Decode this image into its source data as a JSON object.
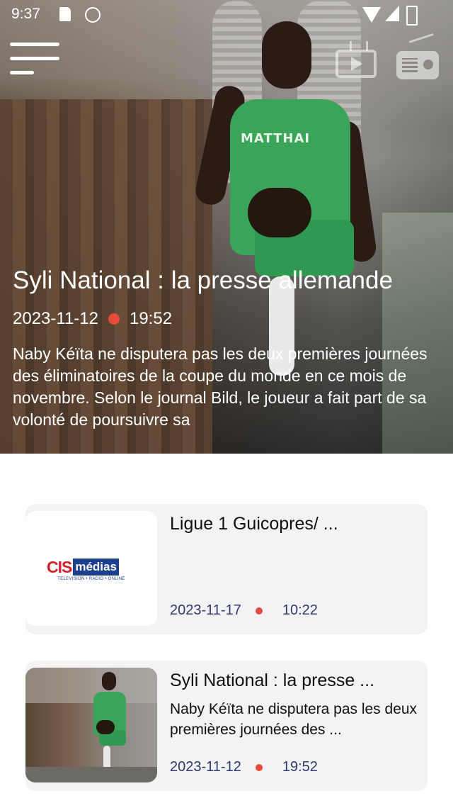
{
  "status_bar": {
    "time": "9:37"
  },
  "header": {
    "menu_icon": "hamburger-menu-icon",
    "tv_icon": "tv-play-icon",
    "radio_icon": "radio-icon"
  },
  "hero": {
    "title": "Syli National : la presse allemande",
    "date": "2023-11-12",
    "time": "19:52",
    "excerpt": "Naby Kéïta ne disputera pas les deux premières journées des éliminatoires de la coupe du monde en ce mois de novembre. Selon le journal Bild, le joueur a fait part de sa volonté de poursuivre sa",
    "jersey_sponsor": "MATTHAI"
  },
  "articles": [
    {
      "title": "Ligue 1 Guicopres/ ...",
      "excerpt": "",
      "date": "2023-11-17",
      "time": "10:22",
      "thumb": {
        "logo_main": "CIS",
        "logo_badge": "médias",
        "logo_sub": "TELEVISION  •  RADIO  •  ONLINE"
      }
    },
    {
      "title": "Syli National : la presse ...",
      "excerpt": "Naby Kéïta ne disputera pas les deux premières journées des ...",
      "date": "2023-11-12",
      "time": "19:52"
    }
  ],
  "colors": {
    "accent_dot": "#e84b3c",
    "meta_text": "#2e3a6e",
    "card_bg": "#f3f3f5",
    "logo_red": "#d61f2a",
    "logo_blue": "#1d3f8f"
  }
}
